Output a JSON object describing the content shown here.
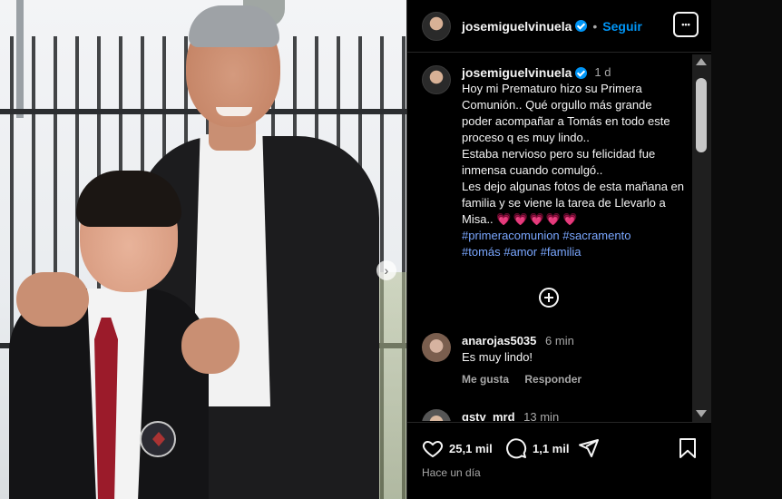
{
  "post": {
    "username": "josemiguelvinuela",
    "separator": "•",
    "follow_label": "Seguir",
    "more_label": "•••",
    "caption_time": "1 d",
    "caption_text": "Hoy mi Prematuro hizo su Primera Comunión.. Qué orgullo más grande poder acompañar a Tomás en todo este proceso q es muy lindo..\nEstaba nervioso pero su felicidad fue inmensa cuando comulgó..\nLes dejo algunas fotos de esta mañana en familia y se viene la tarea de Llevarlo a Misa..",
    "caption_emojis": "💗💗💗💗💗",
    "hashtags_line1": "#primeracomunion #sacramento",
    "hashtags_line2": "#tomás #amor #familia"
  },
  "comments": [
    {
      "username": "anarojas5035",
      "time": "6 min",
      "text": "Es muy lindo!",
      "like_label": "Me gusta",
      "reply_label": "Responder"
    },
    {
      "username": "gstv_mrd",
      "time": "13 min"
    }
  ],
  "footer": {
    "likes": "25,1 mil",
    "comments": "1,1 mil",
    "posted": "Hace un día"
  },
  "photo": {
    "next_arrow": "›"
  }
}
